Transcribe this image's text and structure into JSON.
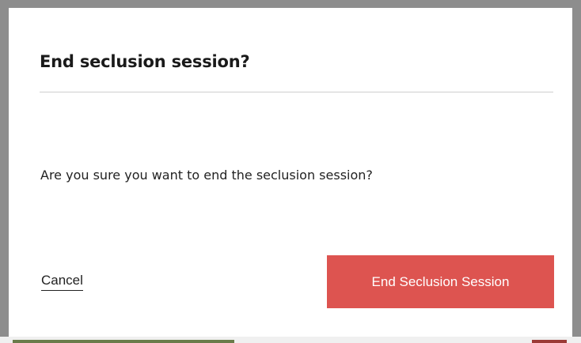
{
  "dialog": {
    "title": "End seclusion session?",
    "message": "Are you sure you want to end the seclusion session?",
    "cancel_label": "Cancel",
    "confirm_label": "End Seclusion Session"
  },
  "colors": {
    "confirm_button": "#dd5450",
    "overlay": "#8d8d8d",
    "dialog_background": "#ffffff",
    "text": "#222222"
  }
}
